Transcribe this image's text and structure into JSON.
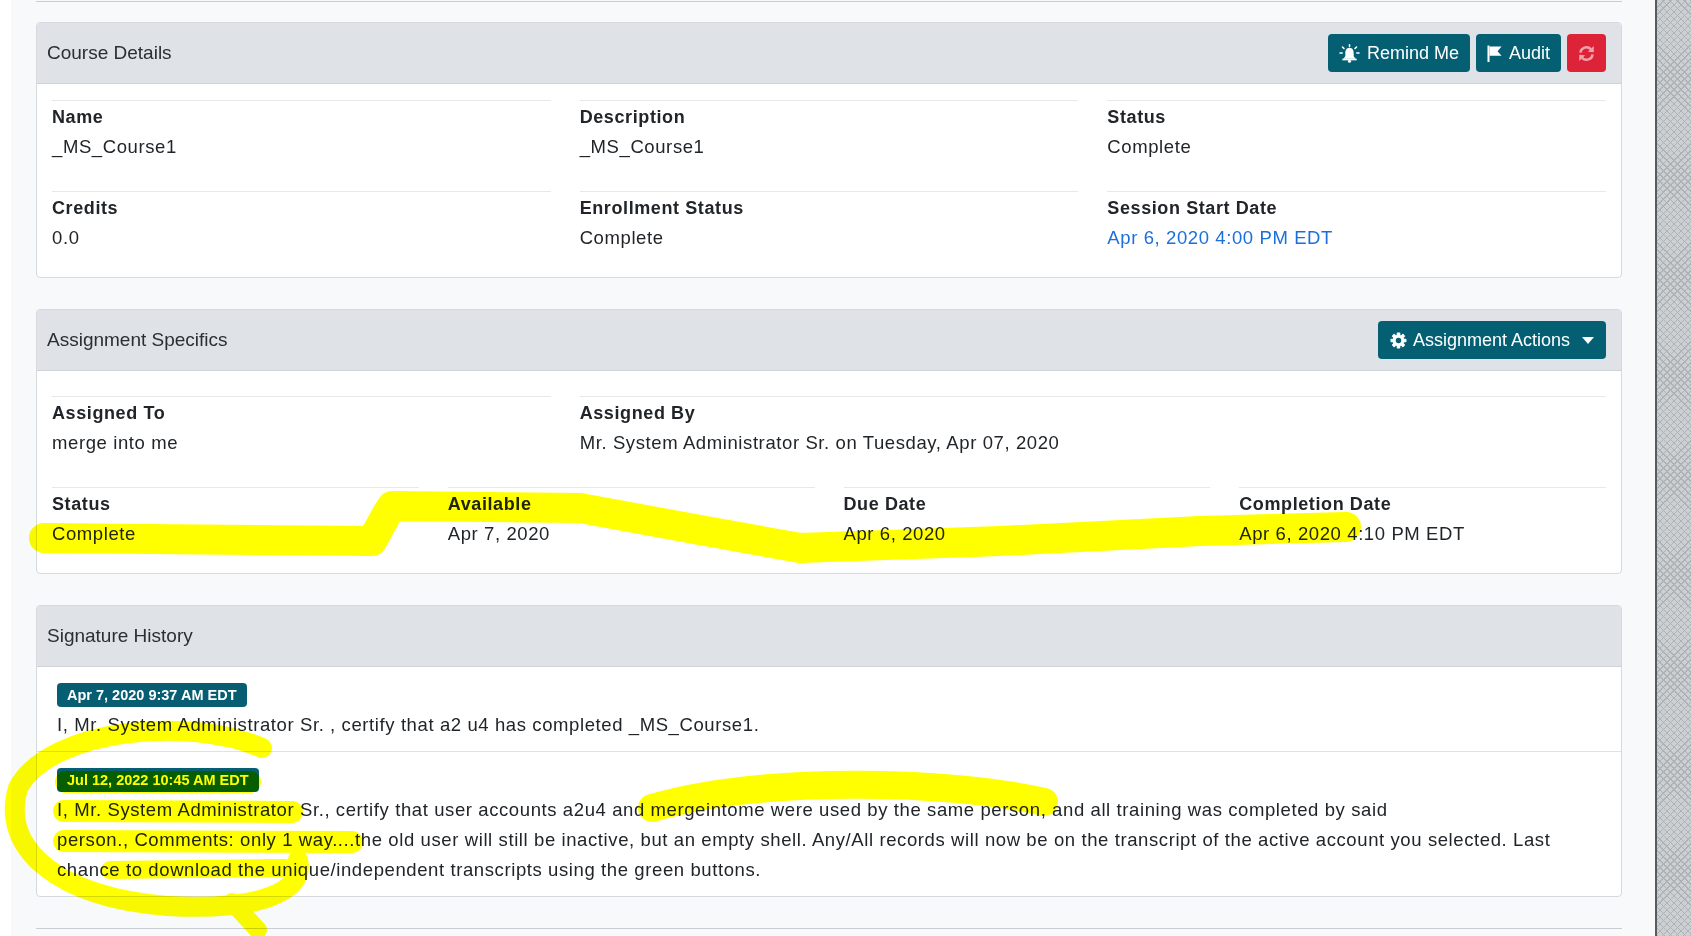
{
  "course_details": {
    "title": "Course Details",
    "buttons": [
      {
        "kind": "remind",
        "label": "Remind Me"
      },
      {
        "kind": "audit",
        "label": "Audit"
      },
      {
        "kind": "refresh"
      }
    ],
    "fields": [
      {
        "label": "Name",
        "value": "_MS_Course1",
        "kind": "text"
      },
      {
        "label": "Description",
        "value": "_MS_Course1",
        "kind": "text"
      },
      {
        "label": "Status",
        "value": "Complete",
        "kind": "text"
      },
      {
        "label": "Credits",
        "value": "0.0",
        "kind": "text"
      },
      {
        "label": "Enrollment Status",
        "value": "Complete",
        "kind": "text"
      },
      {
        "label": "Session Start Date",
        "value": "Apr 6, 2020 4:00 PM EDT",
        "kind": "link"
      }
    ]
  },
  "assignment_specifics": {
    "title": "Assignment Specifics",
    "actions_button": {
      "label": "Assignment Actions"
    },
    "rows": [
      {
        "fields": [
          {
            "label": "Assigned To",
            "value": "merge into me"
          },
          {
            "label": "Assigned By",
            "value": "Mr. System Administrator Sr. on Tuesday, Apr 07, 2020"
          }
        ]
      },
      {
        "fields": [
          {
            "label": "Status",
            "value": "Complete"
          },
          {
            "label": "Available",
            "value": "Apr 7, 2020"
          },
          {
            "label": "Due Date",
            "value": "Apr 6, 2020"
          },
          {
            "label": "Completion Date",
            "value": "Apr 6, 2020 4:10 PM EDT"
          }
        ]
      }
    ]
  },
  "signature_history": {
    "title": "Signature History",
    "entries": [
      {
        "timestamp": "Apr 7, 2020 9:37 AM EDT",
        "text": "I, Mr. System Administrator Sr. , certify that a2 u4 has completed _MS_Course1."
      },
      {
        "timestamp": "Jul 12, 2022 10:45 AM EDT",
        "text": "I, Mr. System Administrator Sr., certify that user accounts a2u4 and mergeintome were used by the same person, and all training was completed by said\nperson., Comments: only 1 way....the old user will still be inactive, but an empty shell. Any/All records will now be on the transcript of the active account you selected. Last chance to download the unique/independent transcripts using the green buttons."
      }
    ]
  }
}
